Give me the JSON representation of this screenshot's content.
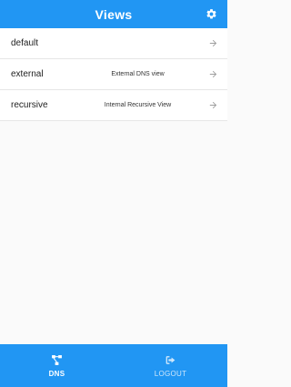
{
  "header": {
    "title": "Views",
    "settings_icon": "gear-icon"
  },
  "views": [
    {
      "name": "default",
      "description": ""
    },
    {
      "name": "external",
      "description": "External DNS view"
    },
    {
      "name": "recursive",
      "description": "Internal Recursive View"
    }
  ],
  "bottom_nav": {
    "dns": {
      "label": "DNS",
      "icon": "network-icon",
      "active": true
    },
    "logout": {
      "label": "LOGOUT",
      "icon": "logout-icon",
      "active": false
    }
  },
  "colors": {
    "accent": "#2196f3",
    "arrow": "#9e9e9e"
  }
}
